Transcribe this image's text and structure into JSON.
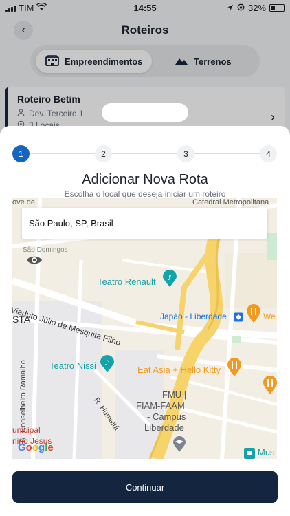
{
  "status_bar": {
    "carrier": "TIM",
    "time": "14:55",
    "battery": "32%"
  },
  "header": {
    "title": "Roteiros"
  },
  "segments": [
    {
      "label": "Empreendimentos",
      "icon": "building-icon"
    },
    {
      "label": "Terrenos",
      "icon": "mountain-icon"
    }
  ],
  "route_card": {
    "title": "Roteiro Betim",
    "owner": "Dev. Terceiro 1",
    "locations": "3 Locais"
  },
  "stepper": {
    "steps": [
      "1",
      "2",
      "3",
      "4"
    ],
    "active": 1
  },
  "sheet": {
    "title": "Adicionar Nova Rota",
    "subtitle": "Escolha o local que deseja iniciar um roteiro"
  },
  "map": {
    "search_value": "São Paulo, SP, Brasil",
    "labels": {
      "domingos": "São Domingos",
      "teatro_renault": "Teatro Renault",
      "viaduto": "Viaduto Júlio de Mesquita Filho",
      "japao": "Japão - Liberdade",
      "we": "We",
      "sta": "STA",
      "teatro_nissi": "Teatro Nissi",
      "eat_asia": "Eat Asia + Hello Kitty",
      "conselheiro": "R. Conselheiro Ramalho",
      "humaita": "R. Humaitá",
      "fmu": "FMU |",
      "fiam": "FIAM-FAAM",
      "campus": "- Campus",
      "liberdade": "Liberdade",
      "municipal": "unicipal",
      "jesus": "nino Jesus",
      "mus": "Mus",
      "metropolitana": "Catedral Metropolitana",
      "rua_ove": "ove de",
      "google": "Google"
    },
    "colors": {
      "road_major": "#f7d36b",
      "road_minor": "#ffffff",
      "teal": "#14a3a8",
      "orange": "#f29a1f",
      "blue": "#1a73e8"
    }
  },
  "actions": {
    "continue_label": "Continuar"
  }
}
